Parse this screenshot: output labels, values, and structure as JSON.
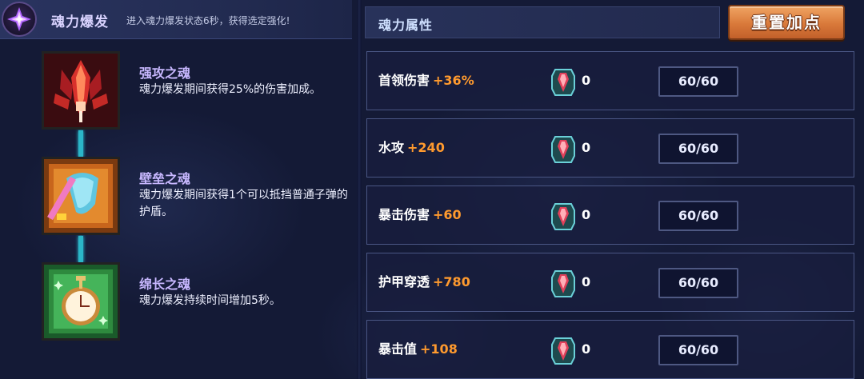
{
  "burst": {
    "title": "魂力爆发",
    "description": "进入魂力爆发状态6秒，获得选定强化!"
  },
  "souls": [
    {
      "name": "强攻之魂",
      "description": "魂力爆发期间获得25%的伤害加成。",
      "icon": "red-crystal-icon"
    },
    {
      "name": "壁垒之魂",
      "description": "魂力爆发期间获得1个可以抵挡普通子弹的护盾。",
      "icon": "shield-sword-icon"
    },
    {
      "name": "绵长之魂",
      "description": "魂力爆发持续时间增加5秒。",
      "icon": "pocket-watch-icon"
    }
  ],
  "attributes": {
    "title": "魂力属性",
    "reset_label": "重置加点",
    "rows": [
      {
        "name": "首领伤害",
        "bonus": "+36%",
        "cost": "0",
        "level": "60/60"
      },
      {
        "name": "水攻",
        "bonus": "+240",
        "cost": "0",
        "level": "60/60"
      },
      {
        "name": "暴击伤害",
        "bonus": "+60",
        "cost": "0",
        "level": "60/60"
      },
      {
        "name": "护甲穿透",
        "bonus": "+780",
        "cost": "0",
        "level": "60/60"
      },
      {
        "name": "暴击值",
        "bonus": "+108",
        "cost": "0",
        "level": "60/60"
      }
    ]
  },
  "colors": {
    "bonus": "#ff9a2e",
    "connector": "#2bb6c8",
    "reset_button": "#d9793a"
  }
}
